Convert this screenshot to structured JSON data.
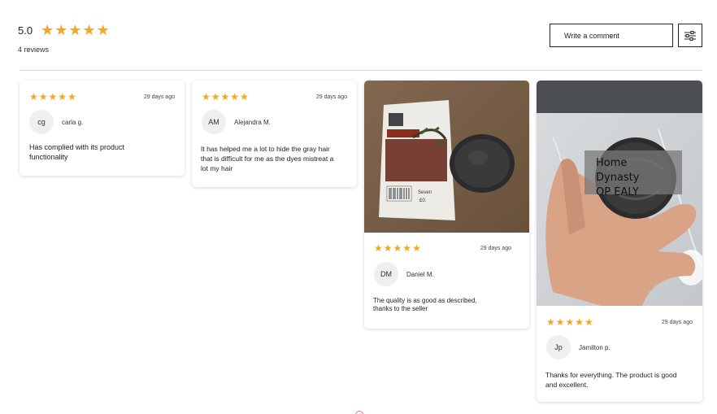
{
  "summary": {
    "rating": "5.0",
    "stars": 5,
    "reviews_count": "4 reviews"
  },
  "actions": {
    "write_comment": "Write a comment",
    "filter_icon": "sliders-icon"
  },
  "colors": {
    "star": "#f5a623",
    "border": "#222222",
    "avatar_bg": "#efefef"
  },
  "reviews": [
    {
      "stars": 5,
      "date": "29 days ago",
      "initials": "cg",
      "name": "carla g.",
      "text": "Has complied with its product functionality",
      "has_photo": false
    },
    {
      "stars": 5,
      "date": "29 days ago",
      "initials": "AM",
      "name": "Alejandra M.",
      "text": "It has helped me a lot to hide the gray hair that is difficult for me as the dyes mistreat a lot my hair",
      "has_photo": false
    },
    {
      "stars": 5,
      "date": "29 days ago",
      "initials": "DM",
      "name": "Daniel M.",
      "text": "The quality is as good as described, thanks to the seller",
      "has_photo": true,
      "photo_text": [
        "Seven",
        "£0."
      ]
    },
    {
      "stars": 5,
      "date": "29 days ago",
      "initials": "Jp",
      "name": "Jamilton p.",
      "text": "Thanks for everything. The product is good and excellent.",
      "has_photo": true,
      "photo_overlay": [
        "Home Dynasty",
        "OP EALY"
      ]
    }
  ]
}
